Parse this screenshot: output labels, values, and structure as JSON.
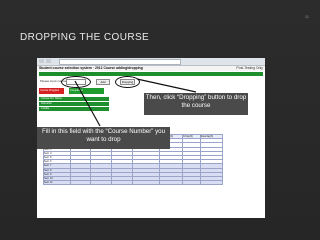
{
  "slide": {
    "title": "DROPPING THE COURSE",
    "page_number": "11"
  },
  "screenshot": {
    "header_title": "Student course selection system · 2012 Course adding/dropping",
    "header_right": "Post-Testing Only",
    "input_label": "Please input course number:",
    "add_label": "Add",
    "drop_label": "Dropping",
    "status_red": "Course Dropped",
    "status_green": "Completed",
    "panel_rows": [
      "Course ID / Name",
      "Instructor",
      "Credits"
    ],
    "grid_header": [
      "Time schedule",
      "Sunday(0)",
      "Monday(1)",
      "Tuesday(2)",
      "Wednesday(3)",
      "Thursday(4)",
      "Friday(5)",
      "Saturday(6)"
    ],
    "grid_rows": [
      "Sect. 1",
      "Sect. 2",
      "Sect. 3",
      "Sect. 4",
      "Sect. 5",
      "Sect. 6",
      "Sect. 7",
      "Sect. 8",
      "Sect. 9",
      "Sect. 10",
      "Sect. 11"
    ]
  },
  "callouts": {
    "drop_instruction": "Then, click “Dropping” button to drop the course",
    "field_instruction": "Fill in this field with the “Course Number” you want to drop"
  }
}
